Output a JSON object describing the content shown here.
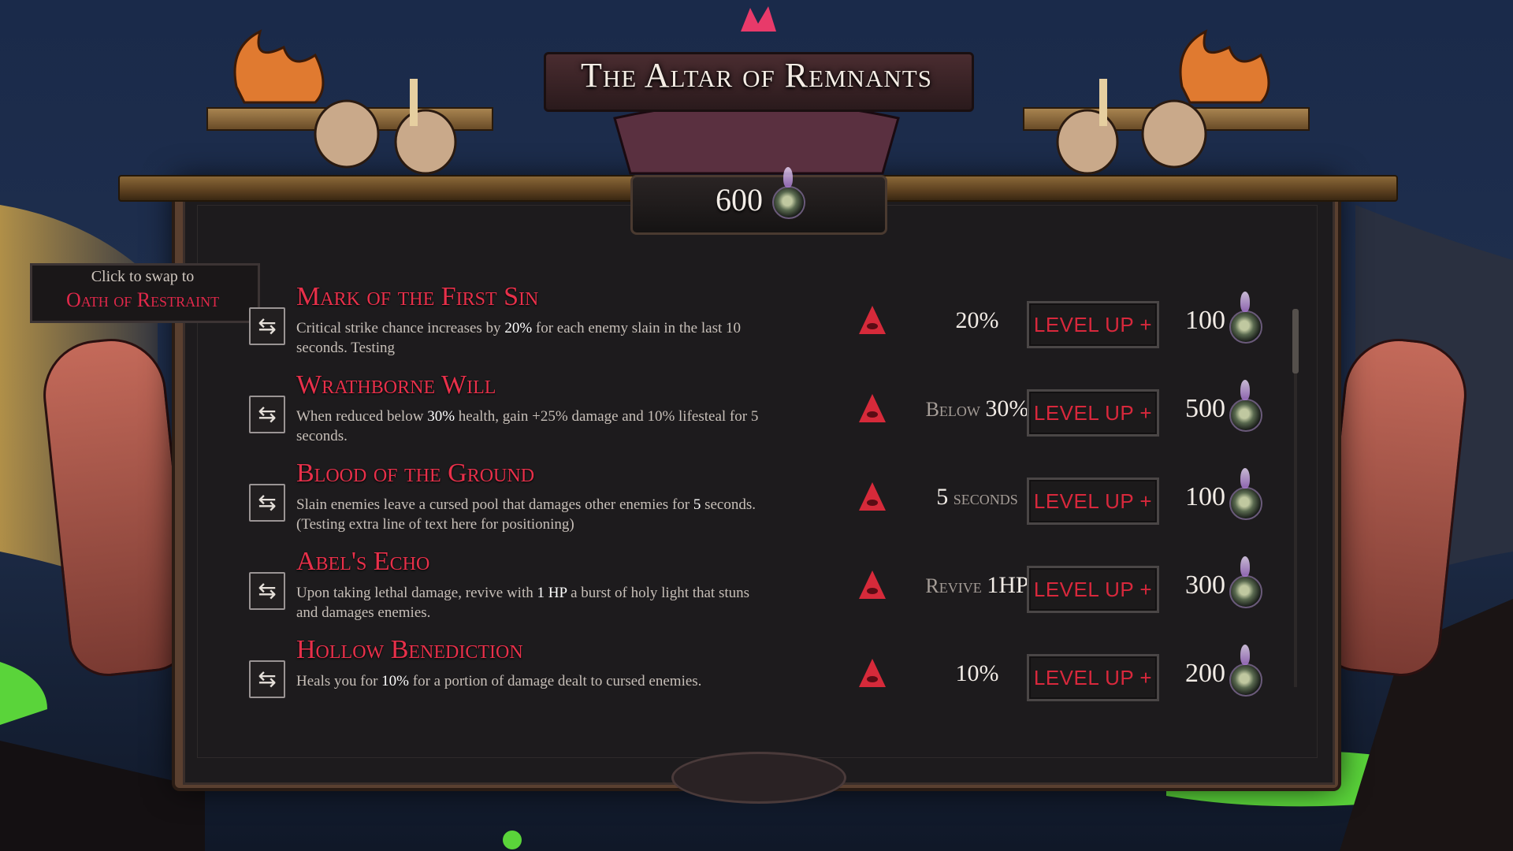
{
  "title": "The Altar of Remnants",
  "currency": "600",
  "swap_tab": {
    "hint": "Click to swap to",
    "name": "Oath of Restraint"
  },
  "button_label": "LEVEL UP +",
  "swap_icon_glyph": "⇆",
  "perks": [
    {
      "name": "Mark of the First Sin",
      "desc_parts": [
        "Critical strike chance increases by ",
        "20%",
        " for each enemy slain in the last 10 seconds. Testing"
      ],
      "stat_prefix": "",
      "stat_value": "20%",
      "stat_suffix": "",
      "cost": "100"
    },
    {
      "name": "Wrathborne Will",
      "desc_parts": [
        "When reduced below ",
        "30%",
        " health, gain +25% damage and 10% lifesteal for 5 seconds."
      ],
      "stat_prefix": "Below ",
      "stat_value": "30%",
      "stat_suffix": "",
      "cost": "500"
    },
    {
      "name": "Blood of the Ground",
      "desc_parts": [
        "Slain enemies leave a cursed pool that damages other enemies for ",
        "5",
        " seconds. (Testing extra line of text here for positioning)"
      ],
      "stat_prefix": "",
      "stat_value": "5",
      "stat_suffix": " seconds",
      "cost": "100"
    },
    {
      "name": "Abel's Echo",
      "desc_parts": [
        "Upon taking lethal damage, revive with ",
        "1 HP",
        " a burst of holy light that stuns and damages enemies."
      ],
      "stat_prefix": "Revive ",
      "stat_value": "1HP",
      "stat_suffix": "",
      "cost": "300"
    },
    {
      "name": "Hollow Benediction",
      "desc_parts": [
        "Heals you for ",
        "10%",
        " for a portion of damage dealt to cursed enemies."
      ],
      "stat_prefix": "",
      "stat_value": "10%",
      "stat_suffix": "",
      "cost": "200"
    }
  ],
  "colors": {
    "accent_red": "#e8304a",
    "frame_wood": "#6a4c28",
    "board": "#1d1b1d"
  }
}
